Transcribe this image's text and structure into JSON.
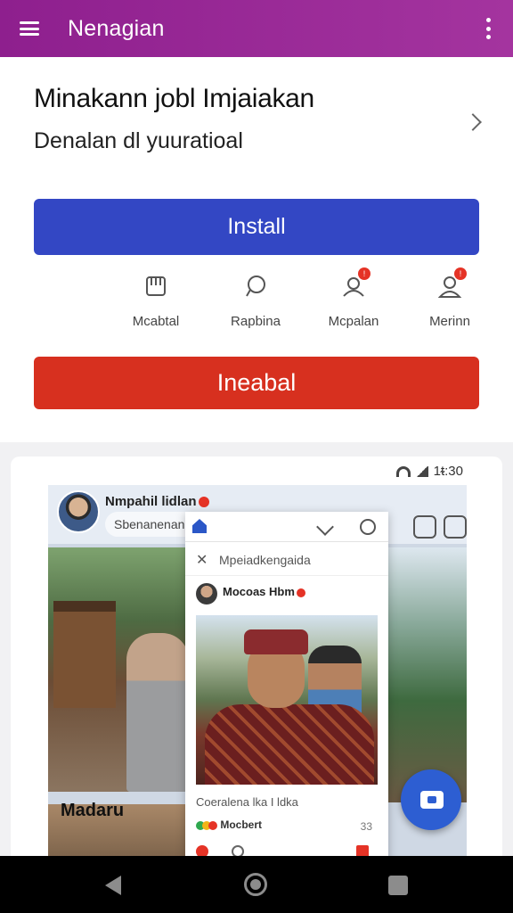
{
  "app_bar": {
    "title": "Nenagian",
    "background": "#9a2b98"
  },
  "app_listing": {
    "name": "Minakann jobl Imjaiakan",
    "subtitle": "Denalan dl yuuratioal",
    "install_label": "Install",
    "open_label": "Ineabal",
    "install_color": "#3347c4",
    "open_color": "#d7301f"
  },
  "actions": [
    {
      "label": "Mcabtal",
      "icon": "bookmark-icon",
      "badge": false
    },
    {
      "label": "Rapbina",
      "icon": "chat-icon",
      "badge": false
    },
    {
      "label": "Mcpalan",
      "icon": "people-icon",
      "badge": true
    },
    {
      "label": "Merinn",
      "icon": "profile-icon",
      "badge": true
    }
  ],
  "screenshot": {
    "status_time": "1ᵵ:30",
    "header_name": "Nmpahil lidlan",
    "header_search": "Sbenanenan",
    "popup_search": "Mpeiadkengaida",
    "popup_user": "Mocoas Hbm",
    "popup_caption": "Coeralena lka I ldka",
    "popup_reaction_label": "Mocbert",
    "popup_reaction_count": "33",
    "caption_label": "Madaru"
  },
  "system_nav": {
    "back": "back-icon",
    "home": "home-icon",
    "recents": "recents-icon"
  }
}
